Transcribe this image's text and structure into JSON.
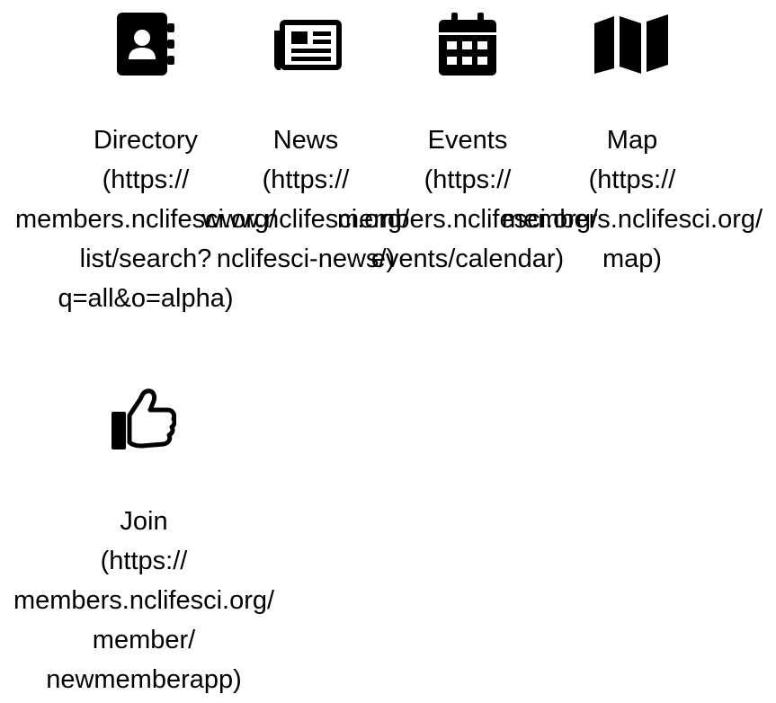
{
  "colors": {
    "icon": "#000000",
    "text": "#000000",
    "background": "#ffffff"
  },
  "tiles": [
    {
      "name": "Directory",
      "icon": "address-book-icon",
      "lines": [
        "Directory",
        "(https://",
        "members.nclifesci.org/",
        "list/search?",
        "q=all&o=alpha)"
      ]
    },
    {
      "name": "News",
      "icon": "newspaper-icon",
      "lines": [
        "News",
        "(https://",
        "www.nclifesci.org/",
        "nclifesci-news/)"
      ]
    },
    {
      "name": "Events",
      "icon": "calendar-icon",
      "lines": [
        "Events",
        "(https://",
        "members.nclifesci.org/",
        "events/calendar)"
      ]
    },
    {
      "name": "Map",
      "icon": "map-icon",
      "lines": [
        "Map",
        "(https://",
        "members.nclifesci.org/",
        "map)"
      ]
    },
    {
      "name": "Join",
      "icon": "thumbs-up-icon",
      "lines": [
        "Join",
        "(https://",
        "members.nclifesci.org/",
        "member/",
        "newmemberapp)"
      ]
    }
  ]
}
